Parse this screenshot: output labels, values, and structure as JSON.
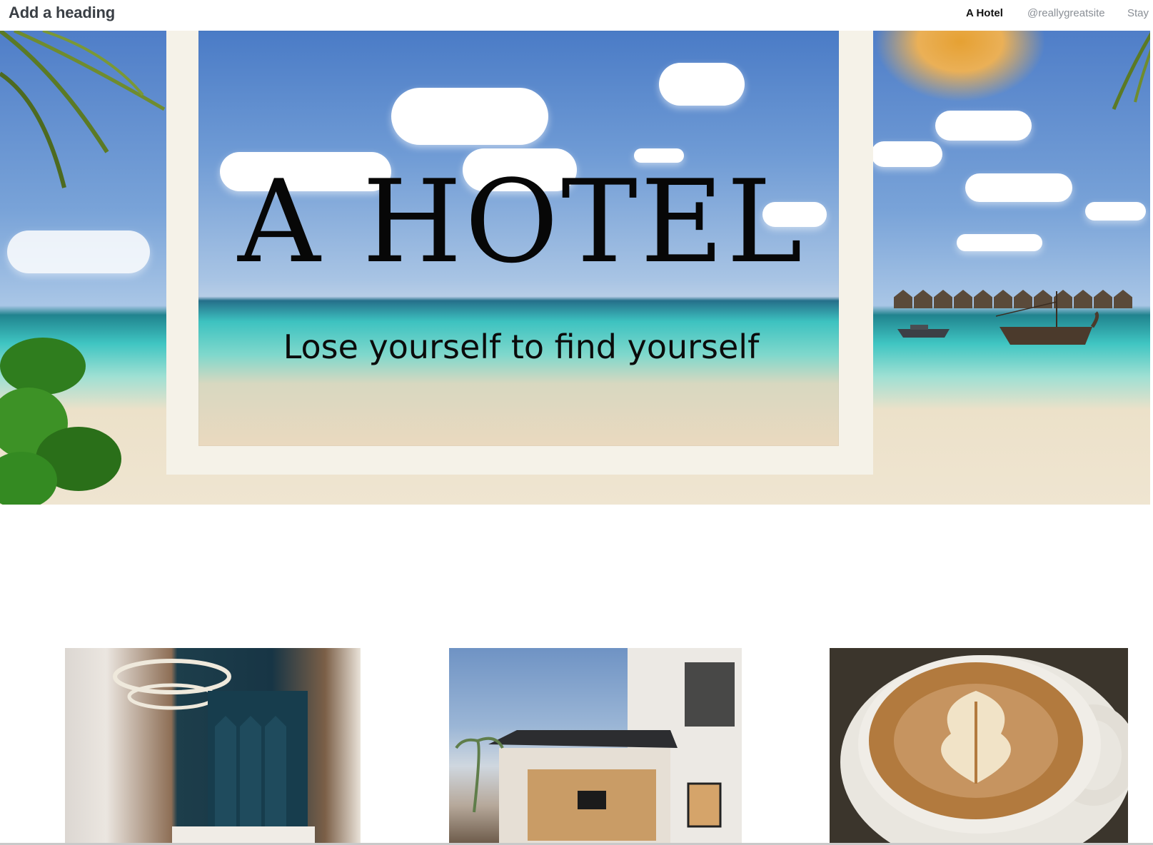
{
  "header": {
    "heading": "Add a heading",
    "nav": [
      {
        "label": "A Hotel"
      },
      {
        "label": "@reallygreatsite"
      },
      {
        "label": "Stay"
      }
    ]
  },
  "hero": {
    "title": "A HOTEL",
    "subtitle": "Lose yourself to find yourself"
  },
  "gallery": [
    {
      "icon": "hotel-bedroom-photo"
    },
    {
      "icon": "villa-exterior-photo"
    },
    {
      "icon": "latte-coffee-photo"
    }
  ],
  "colors": {
    "heading": "#3a3f45",
    "nav_active": "#111111",
    "nav_inactive": "#8a8f96",
    "frame": "#f5f2e8"
  }
}
